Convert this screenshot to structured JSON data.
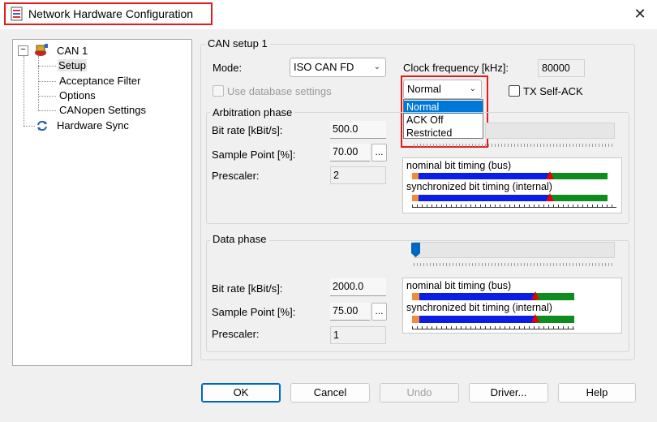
{
  "window": {
    "title": "Network Hardware Configuration",
    "close_glyph": "✕"
  },
  "tree": {
    "items": [
      {
        "label": "CAN 1",
        "expander": "−"
      },
      {
        "label": "Setup"
      },
      {
        "label": "Acceptance Filter"
      },
      {
        "label": "Options"
      },
      {
        "label": "CANopen Settings"
      },
      {
        "label": "Hardware Sync"
      }
    ]
  },
  "setup": {
    "group_title": "CAN setup 1",
    "mode_label": "Mode:",
    "mode_value": "ISO CAN FD",
    "clock_label": "Clock frequency [kHz]:",
    "clock_value": "80000",
    "use_db_label": "Use database settings",
    "tx_self_ack_label": "TX Self-ACK",
    "ack_combo_value": "Normal",
    "ack_options": [
      "Normal",
      "ACK Off",
      "Restricted"
    ]
  },
  "arbitration": {
    "title": "Arbitration phase",
    "bitrate_label": "Bit rate [kBit/s]:",
    "bitrate_value": "500.0",
    "sample_label": "Sample Point [%]:",
    "sample_value": "70.00",
    "prescaler_label": "Prescaler:",
    "prescaler_value": "2",
    "ellipsis": "...",
    "nominal_label": "nominal bit timing (bus)",
    "sync_label": "synchronized bit timing (internal)"
  },
  "data_phase": {
    "title": "Data phase",
    "bitrate_label": "Bit rate [kBit/s]:",
    "bitrate_value": "2000.0",
    "sample_label": "Sample Point [%]:",
    "sample_value": "75.00",
    "prescaler_label": "Prescaler:",
    "prescaler_value": "1",
    "ellipsis": "...",
    "nominal_label": "nominal bit timing (bus)",
    "sync_label": "synchronized bit timing (internal)"
  },
  "buttons": {
    "ok": "OK",
    "cancel": "Cancel",
    "undo": "Undo",
    "driver": "Driver...",
    "help": "Help"
  },
  "colors": {
    "highlight_red": "#e31b1b",
    "timing_orange": "#f08a3c",
    "timing_blue": "#0a1ee6",
    "timing_green": "#0f8c1e",
    "sample_marker_red": "#e60000",
    "selection_blue": "#0078d7"
  }
}
